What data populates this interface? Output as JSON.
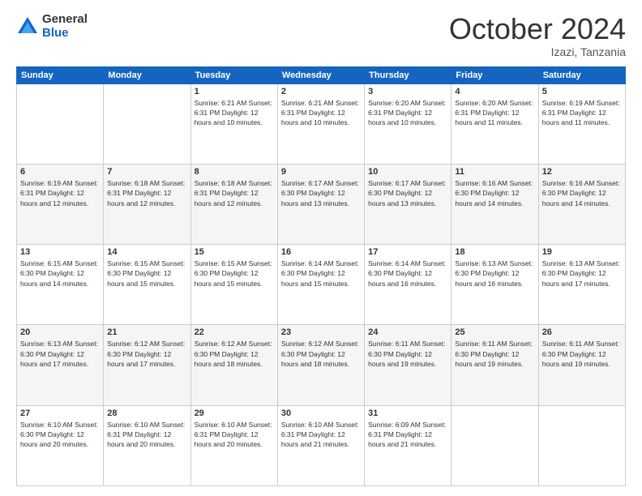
{
  "logo": {
    "general": "General",
    "blue": "Blue"
  },
  "title": {
    "month": "October 2024",
    "location": "Izazi, Tanzania"
  },
  "weekdays": [
    "Sunday",
    "Monday",
    "Tuesday",
    "Wednesday",
    "Thursday",
    "Friday",
    "Saturday"
  ],
  "weeks": [
    [
      {
        "day": "",
        "info": ""
      },
      {
        "day": "",
        "info": ""
      },
      {
        "day": "1",
        "info": "Sunrise: 6:21 AM\nSunset: 6:31 PM\nDaylight: 12 hours\nand 10 minutes."
      },
      {
        "day": "2",
        "info": "Sunrise: 6:21 AM\nSunset: 6:31 PM\nDaylight: 12 hours\nand 10 minutes."
      },
      {
        "day": "3",
        "info": "Sunrise: 6:20 AM\nSunset: 6:31 PM\nDaylight: 12 hours\nand 10 minutes."
      },
      {
        "day": "4",
        "info": "Sunrise: 6:20 AM\nSunset: 6:31 PM\nDaylight: 12 hours\nand 11 minutes."
      },
      {
        "day": "5",
        "info": "Sunrise: 6:19 AM\nSunset: 6:31 PM\nDaylight: 12 hours\nand 11 minutes."
      }
    ],
    [
      {
        "day": "6",
        "info": "Sunrise: 6:19 AM\nSunset: 6:31 PM\nDaylight: 12 hours\nand 12 minutes."
      },
      {
        "day": "7",
        "info": "Sunrise: 6:18 AM\nSunset: 6:31 PM\nDaylight: 12 hours\nand 12 minutes."
      },
      {
        "day": "8",
        "info": "Sunrise: 6:18 AM\nSunset: 6:31 PM\nDaylight: 12 hours\nand 12 minutes."
      },
      {
        "day": "9",
        "info": "Sunrise: 6:17 AM\nSunset: 6:30 PM\nDaylight: 12 hours\nand 13 minutes."
      },
      {
        "day": "10",
        "info": "Sunrise: 6:17 AM\nSunset: 6:30 PM\nDaylight: 12 hours\nand 13 minutes."
      },
      {
        "day": "11",
        "info": "Sunrise: 6:16 AM\nSunset: 6:30 PM\nDaylight: 12 hours\nand 14 minutes."
      },
      {
        "day": "12",
        "info": "Sunrise: 6:16 AM\nSunset: 6:30 PM\nDaylight: 12 hours\nand 14 minutes."
      }
    ],
    [
      {
        "day": "13",
        "info": "Sunrise: 6:15 AM\nSunset: 6:30 PM\nDaylight: 12 hours\nand 14 minutes."
      },
      {
        "day": "14",
        "info": "Sunrise: 6:15 AM\nSunset: 6:30 PM\nDaylight: 12 hours\nand 15 minutes."
      },
      {
        "day": "15",
        "info": "Sunrise: 6:15 AM\nSunset: 6:30 PM\nDaylight: 12 hours\nand 15 minutes."
      },
      {
        "day": "16",
        "info": "Sunrise: 6:14 AM\nSunset: 6:30 PM\nDaylight: 12 hours\nand 15 minutes."
      },
      {
        "day": "17",
        "info": "Sunrise: 6:14 AM\nSunset: 6:30 PM\nDaylight: 12 hours\nand 16 minutes."
      },
      {
        "day": "18",
        "info": "Sunrise: 6:13 AM\nSunset: 6:30 PM\nDaylight: 12 hours\nand 16 minutes."
      },
      {
        "day": "19",
        "info": "Sunrise: 6:13 AM\nSunset: 6:30 PM\nDaylight: 12 hours\nand 17 minutes."
      }
    ],
    [
      {
        "day": "20",
        "info": "Sunrise: 6:13 AM\nSunset: 6:30 PM\nDaylight: 12 hours\nand 17 minutes."
      },
      {
        "day": "21",
        "info": "Sunrise: 6:12 AM\nSunset: 6:30 PM\nDaylight: 12 hours\nand 17 minutes."
      },
      {
        "day": "22",
        "info": "Sunrise: 6:12 AM\nSunset: 6:30 PM\nDaylight: 12 hours\nand 18 minutes."
      },
      {
        "day": "23",
        "info": "Sunrise: 6:12 AM\nSunset: 6:30 PM\nDaylight: 12 hours\nand 18 minutes."
      },
      {
        "day": "24",
        "info": "Sunrise: 6:11 AM\nSunset: 6:30 PM\nDaylight: 12 hours\nand 19 minutes."
      },
      {
        "day": "25",
        "info": "Sunrise: 6:11 AM\nSunset: 6:30 PM\nDaylight: 12 hours\nand 19 minutes."
      },
      {
        "day": "26",
        "info": "Sunrise: 6:11 AM\nSunset: 6:30 PM\nDaylight: 12 hours\nand 19 minutes."
      }
    ],
    [
      {
        "day": "27",
        "info": "Sunrise: 6:10 AM\nSunset: 6:30 PM\nDaylight: 12 hours\nand 20 minutes."
      },
      {
        "day": "28",
        "info": "Sunrise: 6:10 AM\nSunset: 6:31 PM\nDaylight: 12 hours\nand 20 minutes."
      },
      {
        "day": "29",
        "info": "Sunrise: 6:10 AM\nSunset: 6:31 PM\nDaylight: 12 hours\nand 20 minutes."
      },
      {
        "day": "30",
        "info": "Sunrise: 6:10 AM\nSunset: 6:31 PM\nDaylight: 12 hours\nand 21 minutes."
      },
      {
        "day": "31",
        "info": "Sunrise: 6:09 AM\nSunset: 6:31 PM\nDaylight: 12 hours\nand 21 minutes."
      },
      {
        "day": "",
        "info": ""
      },
      {
        "day": "",
        "info": ""
      }
    ]
  ]
}
